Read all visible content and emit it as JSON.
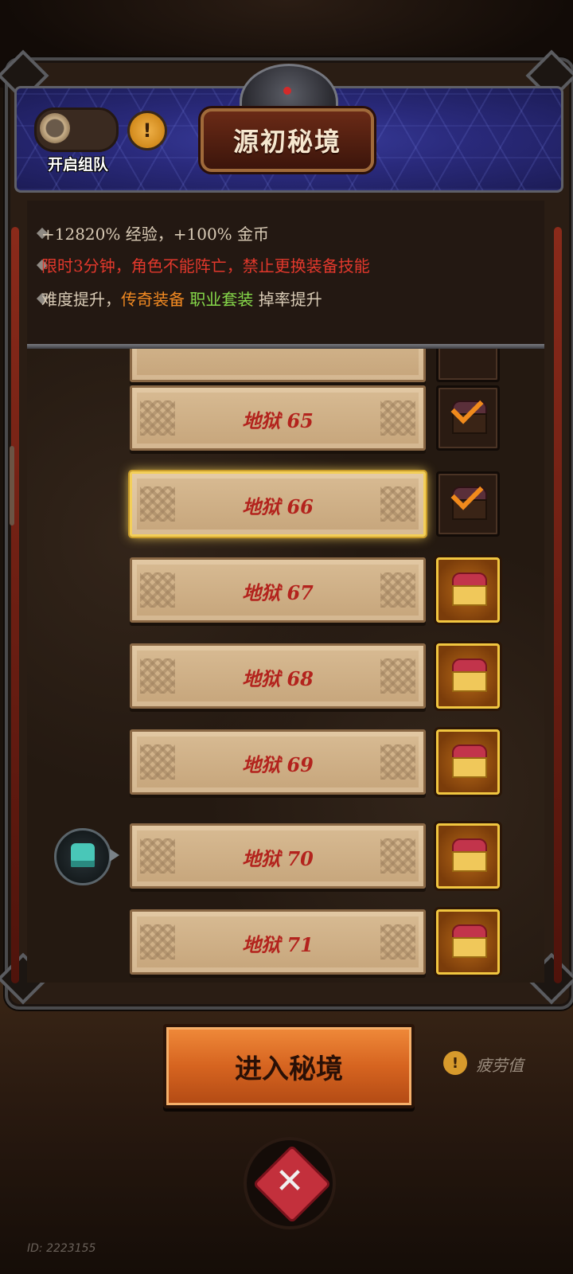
{
  "header": {
    "title": "源初秘境",
    "team_label": "开启组队",
    "info_glyph": "!"
  },
  "description": {
    "line1": "+12820% 经验，+100% 金币",
    "line2": "限时3分钟，角色不能阵亡，禁止更换装备技能",
    "line3": {
      "prefix": "难度提升，",
      "legendary": "传奇装备",
      "set": "职业套装",
      "suffix": " 掉率提升"
    }
  },
  "levels": [
    {
      "label": "地狱 65",
      "reward": "claimed"
    },
    {
      "label": "地狱 66",
      "reward": "claimed",
      "selected": true
    },
    {
      "label": "地狱 67",
      "reward": "available"
    },
    {
      "label": "地狱 68",
      "reward": "available"
    },
    {
      "label": "地狱 69",
      "reward": "available"
    },
    {
      "label": "地狱 70",
      "reward": "available",
      "current": true
    },
    {
      "label": "地狱 71",
      "reward": "available"
    }
  ],
  "footer": {
    "enter_button": "进入秘境",
    "fatigue_glyph": "!",
    "fatigue_label": "疲劳值",
    "player_id": "ID: 2223155"
  },
  "icons": {
    "team_toggle": "toggle-off",
    "reward_claimed": "chest-check-icon",
    "reward_available": "chest-icon",
    "player_marker": "helmet-icon",
    "battle": "crossed-swords-icon"
  },
  "colors": {
    "line1": "#d9cbb6",
    "line2": "#e2382c",
    "line3": "#d9cbb6",
    "legendary": "#f28a22",
    "set": "#86d94a",
    "accent_gold": "#f3cf59",
    "level_text": "#b3231d"
  }
}
